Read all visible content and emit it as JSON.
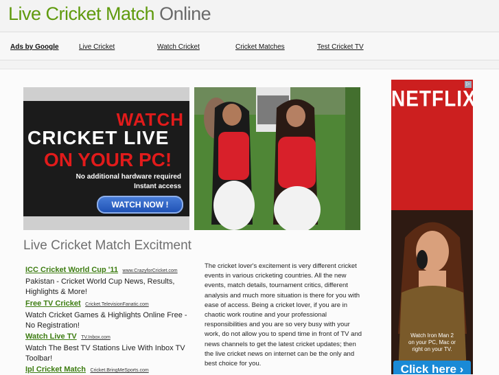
{
  "header": {
    "title_part1": "Live Cricket Match",
    "title_part2": "Online"
  },
  "nav": {
    "items": [
      "Ads by Google",
      "Live Cricket",
      "Watch Cricket",
      "Cricket Matches",
      "Test Cricket TV"
    ]
  },
  "banner": {
    "line1": "WATCH",
    "line2": "CRICKET LIVE",
    "line3": "ON YOUR PC!",
    "note1": "No additional hardware required",
    "note2": "Instant access",
    "button": "WATCH NOW !"
  },
  "section_title": "Live Cricket Match Excitment",
  "ads": [
    {
      "title": "ICC Cricket World Cup '11",
      "url": "www.CrazyforCricket.com",
      "desc": "Pakistan - Cricket World Cup News, Results, Highlights & More!"
    },
    {
      "title": "Free TV Cricket",
      "url": "Cricket.TelevisionFanatic.com",
      "desc": "Watch Cricket Games & Highlights Online Free - No Registration!"
    },
    {
      "title": "Watch Live TV",
      "url": "TV.Inbox.com",
      "desc": "Watch The Best TV Stations Live With Inbox TV Toolbar!"
    },
    {
      "title": "Ipl Cricket Match",
      "url": "Cricket.BringMeSports.com",
      "desc": ""
    }
  ],
  "body_text": "The cricket lover's excitement is very different cricket events in various cricketing countries. All the new events, match details, tournament critics, different analysis and much more situation is there for you with ease of access. Being a cricket lover, if you are in chaotic work routine and your professional responsibilities and you are so very busy with your work, do not allow you to spend time in front of TV and news channels to get the latest cricket updates; then the live cricket news on internet can be the only and best choice for you.",
  "sidebar_ad": {
    "logo": "NETFLIX",
    "caption1": "Watch Iron Man 2",
    "caption2": "on your PC, Mac or",
    "caption3": "right on your TV.",
    "button": "Click here ›"
  }
}
